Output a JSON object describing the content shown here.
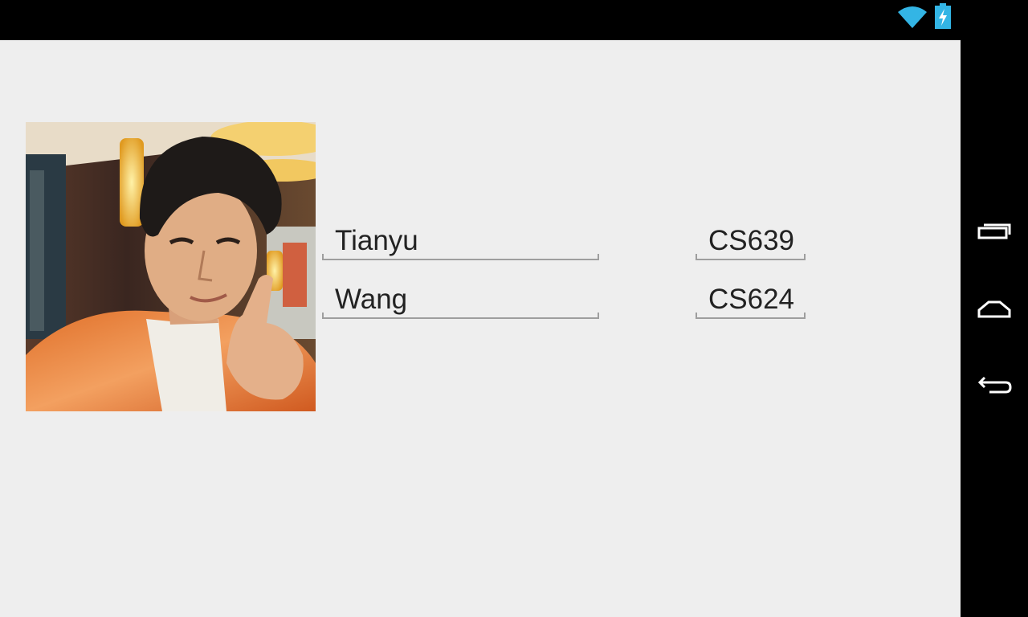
{
  "status_bar": {
    "icons": [
      "wifi-icon",
      "battery-charging-icon"
    ],
    "accent_color": "#33b5e5"
  },
  "profile": {
    "photo": "profile-photo",
    "first_name": "Tianyu",
    "last_name": "Wang",
    "course_1": "CS639",
    "course_2": "CS624"
  },
  "nav_bar": {
    "buttons": [
      "recent-apps-icon",
      "home-icon",
      "back-icon"
    ]
  },
  "colors": {
    "app_background": "#eeeeee",
    "system_bars": "#000000",
    "text": "#222222",
    "underline": "#9e9e9e"
  }
}
